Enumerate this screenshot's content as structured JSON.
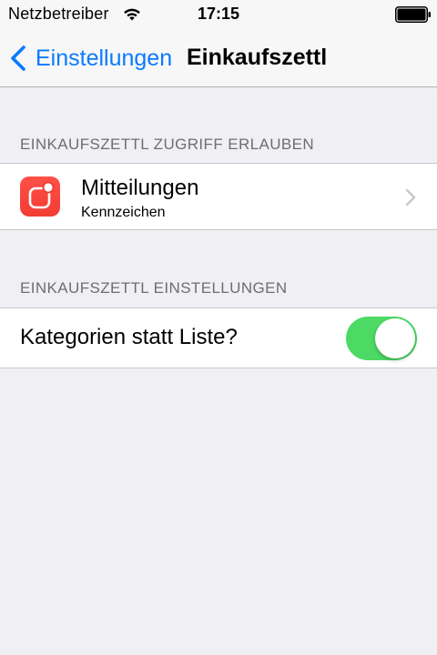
{
  "status_bar": {
    "carrier": "Netzbetreiber",
    "time": "17:15",
    "wifi_icon": "wifi-icon",
    "battery_icon": "battery-icon"
  },
  "nav": {
    "back_label": "Einstellungen",
    "title": "Einkaufszettl",
    "accent_color": "#0a7aff"
  },
  "sections": [
    {
      "header": "EINKAUFSZETTL ZUGRIFF ERLAUBEN",
      "rows": [
        {
          "title": "Mitteilungen",
          "subtitle": "Kennzeichen",
          "icon": "notifications-app-icon",
          "icon_color": "#f23c33",
          "accessory": "chevron-right-icon"
        }
      ]
    },
    {
      "header": "EINKAUFSZETTL EINSTELLUNGEN",
      "rows": [
        {
          "title": "Kategorien statt Liste?",
          "toggle_on": true,
          "toggle_color": "#4cd964"
        }
      ]
    }
  ]
}
